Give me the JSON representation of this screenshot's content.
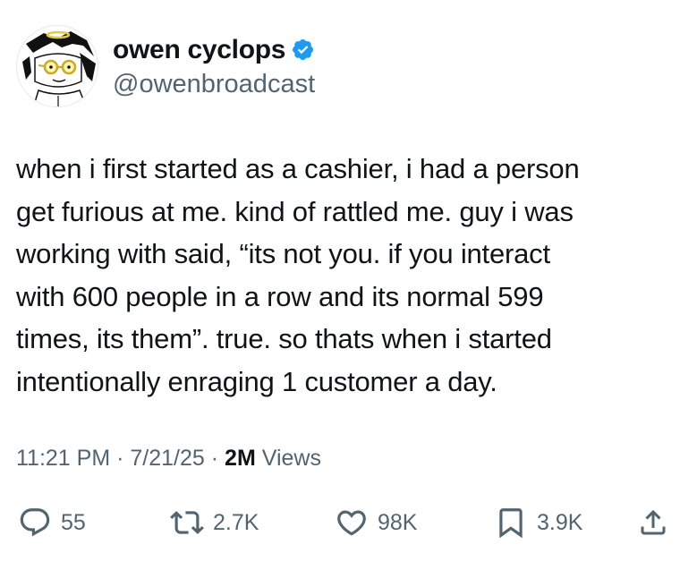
{
  "author": {
    "display_name": "owen cyclops",
    "handle": "@owenbroadcast",
    "verified": true
  },
  "tweet": {
    "lines": [
      "when i first started as a cashier, i had a person",
      "get furious at me. kind of rattled me. guy i was",
      "working with said, “its not you. if you interact",
      "with 600 people in a row and its normal 599",
      "times, its them”. true. so thats when i started",
      "intentionally enraging 1 customer a day."
    ]
  },
  "meta": {
    "time": "11:21 PM",
    "separator": "·",
    "date": "7/21/25",
    "views_count": "2M",
    "views_label": "Views"
  },
  "actions": {
    "reply_count": "55",
    "retweet_count": "2.7K",
    "like_count": "98K",
    "bookmark_count": "3.9K"
  },
  "colors": {
    "text": "#0f1419",
    "secondary": "#536471",
    "verified": "#1d9bf0",
    "background": "#ffffff"
  },
  "icons": {
    "reply": "reply-icon",
    "retweet": "retweet-icon",
    "like": "heart-icon",
    "bookmark": "bookmark-icon",
    "share": "share-icon",
    "verified": "verified-badge-icon"
  }
}
